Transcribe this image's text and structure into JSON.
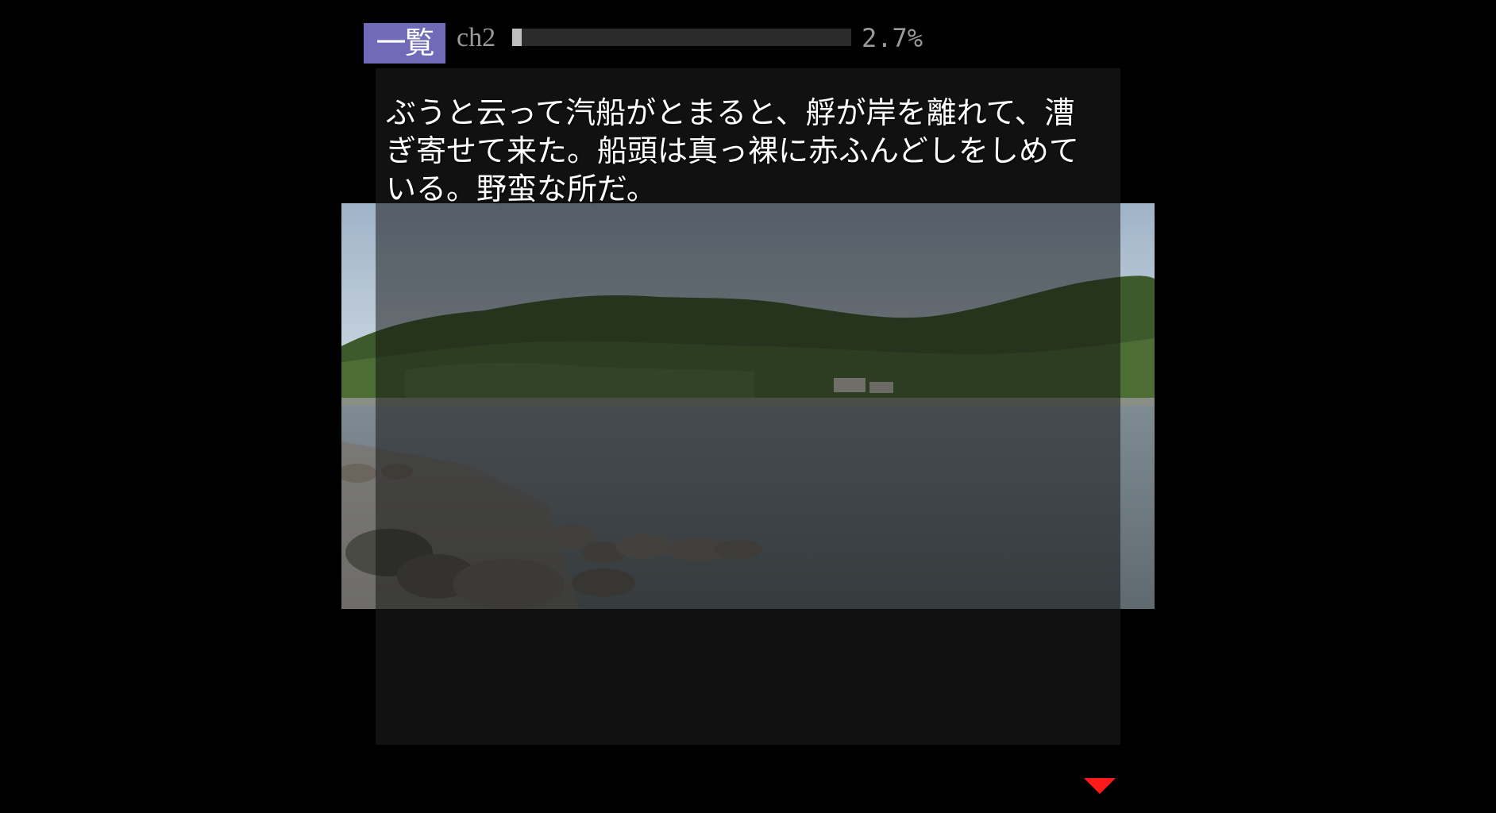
{
  "top_bar": {
    "menu_label": "一覧",
    "chapter": "ch2",
    "progress_percent": 2.7,
    "progress_text": "2.7%"
  },
  "message": {
    "text": "ぶうと云って汽船がとまると、艀が岸を離れて、漕ぎ寄せて来た。船頭は真っ裸に赤ふんどしをしめている。野蛮な所だ。"
  },
  "scene": {
    "description_icon": "background-photo-bay-icon"
  },
  "controls": {
    "next_indicator_icon": "next-page-arrow-icon"
  },
  "colors": {
    "menu_button": "#6f6bb8",
    "next_indicator": "#ff1a1a",
    "window": "#111111"
  }
}
